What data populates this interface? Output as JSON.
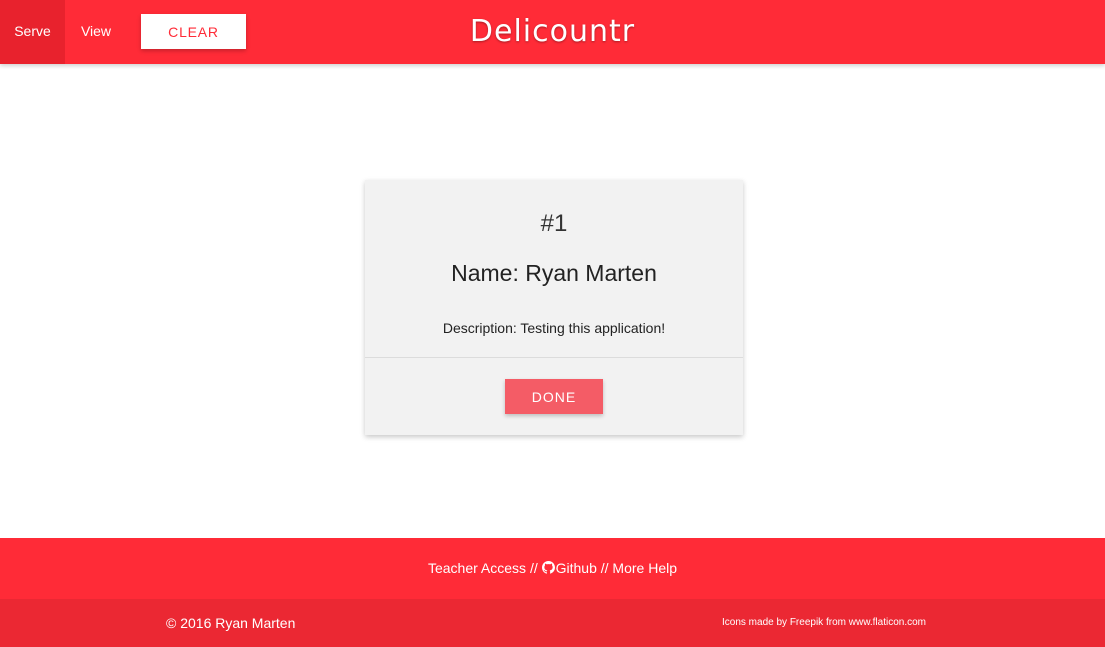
{
  "navbar": {
    "tabs": [
      {
        "label": "Serve",
        "active": true
      },
      {
        "label": "View",
        "active": false
      }
    ],
    "clear_label": "CLEAR",
    "brand": "Delicountr",
    "color": "#ff2b37"
  },
  "card": {
    "number": "#1",
    "name": "Name: Ryan Marten",
    "description": "Description: Testing this application!",
    "done_label": "DONE"
  },
  "footer": {
    "links": {
      "teacher": "Teacher Access",
      "sep1": "//",
      "github_icon": "github-icon",
      "github": "Github",
      "sep2": "//",
      "help": "More Help"
    },
    "copyright": "© 2016 Ryan Marten",
    "credits": {
      "prefix": "Icons made by",
      "author": "Freepik",
      "middle": "from",
      "site": "www.flaticon.com"
    }
  }
}
